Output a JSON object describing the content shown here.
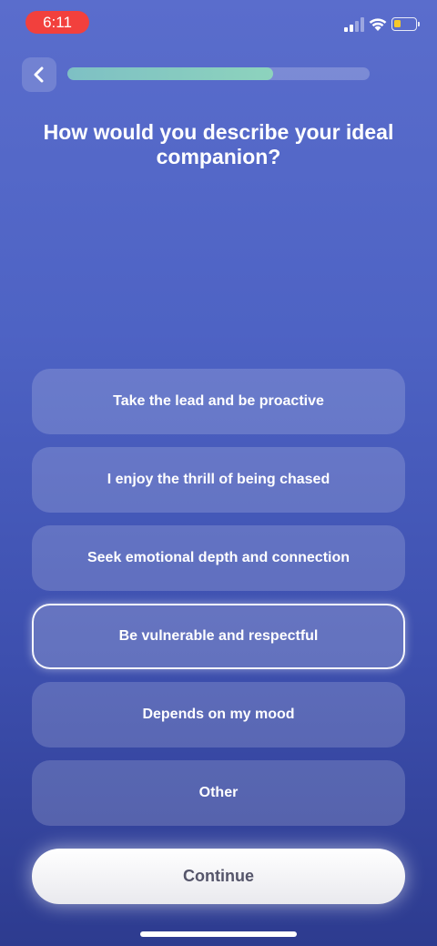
{
  "status_bar": {
    "time": "6:11",
    "battery_level": 0.25,
    "icons": [
      "signal-icon",
      "wifi-icon",
      "battery-icon"
    ]
  },
  "header": {
    "back_icon": "chevron-left-icon",
    "progress": 0.68
  },
  "question": {
    "title": "How would you describe your ideal companion?"
  },
  "options": [
    {
      "label": "Take the lead and be proactive",
      "selected": false
    },
    {
      "label": "I enjoy the thrill of being chased",
      "selected": false
    },
    {
      "label": "Seek emotional depth and connection",
      "selected": false
    },
    {
      "label": "Be vulnerable and respectful",
      "selected": true
    },
    {
      "label": "Depends on my mood",
      "selected": false
    },
    {
      "label": "Other",
      "selected": false
    }
  ],
  "footer": {
    "continue_label": "Continue"
  },
  "colors": {
    "background_top": "#5a6dcc",
    "background_bottom": "#2d3b8f",
    "status_pill": "#f2403d",
    "progress_fill": "#8dd3bd",
    "battery": "#f5c82b"
  }
}
